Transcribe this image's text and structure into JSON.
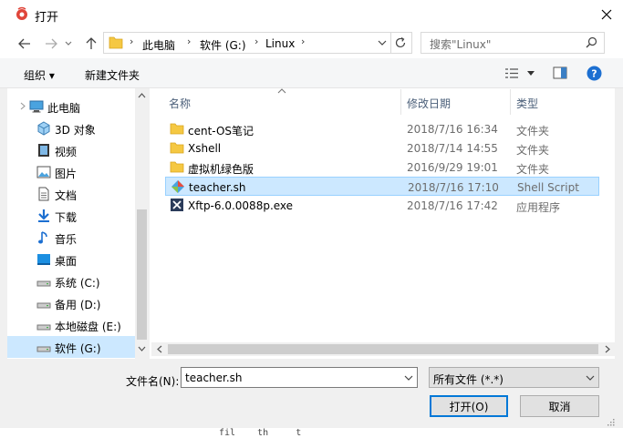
{
  "window": {
    "title": "打开"
  },
  "address": {
    "items": [
      "此电脑",
      "软件 (G:)",
      "Linux"
    ]
  },
  "search": {
    "placeholder": "搜索\"Linux\""
  },
  "toolbar": {
    "organize": "组织 ▾",
    "new_folder": "新建文件夹"
  },
  "nav": {
    "items": [
      {
        "label": "此电脑",
        "icon": "computer-icon"
      },
      {
        "label": "3D 对象",
        "icon": "3d-objects-icon"
      },
      {
        "label": "视频",
        "icon": "video-icon"
      },
      {
        "label": "图片",
        "icon": "pictures-icon"
      },
      {
        "label": "文档",
        "icon": "documents-icon"
      },
      {
        "label": "下载",
        "icon": "downloads-icon"
      },
      {
        "label": "音乐",
        "icon": "music-icon"
      },
      {
        "label": "桌面",
        "icon": "desktop-icon"
      },
      {
        "label": "系统 (C:)",
        "icon": "drive-icon"
      },
      {
        "label": "备用 (D:)",
        "icon": "drive-icon"
      },
      {
        "label": "本地磁盘 (E:)",
        "icon": "drive-icon"
      },
      {
        "label": "软件 (G:)",
        "icon": "drive-icon"
      }
    ]
  },
  "columns": {
    "name": "名称",
    "date": "修改日期",
    "type": "类型"
  },
  "files": [
    {
      "name": "cent-OS笔记",
      "date": "2018/7/16 16:34",
      "type": "文件夹",
      "icon": "folder-icon"
    },
    {
      "name": "Xshell",
      "date": "2018/7/14 14:55",
      "type": "文件夹",
      "icon": "folder-icon"
    },
    {
      "name": "虚拟机绿色版",
      "date": "2016/9/29 19:01",
      "type": "文件夹",
      "icon": "folder-icon"
    },
    {
      "name": "teacher.sh",
      "date": "2018/7/16 17:10",
      "type": "Shell Script",
      "icon": "script-icon"
    },
    {
      "name": "Xftp-6.0.0088p.exe",
      "date": "2018/7/16 17:42",
      "type": "应用程序",
      "icon": "exe-icon"
    }
  ],
  "bottom": {
    "filename_label": "文件名(N):",
    "filename_value": "teacher.sh",
    "filter_value": "所有文件 (*.*)",
    "open_label": "打开(O)",
    "cancel_label": "取消"
  },
  "background": {
    "peek_text": "fil    th     t"
  },
  "colors": {
    "selection": "#cce8ff",
    "accent": "#0078d7"
  }
}
